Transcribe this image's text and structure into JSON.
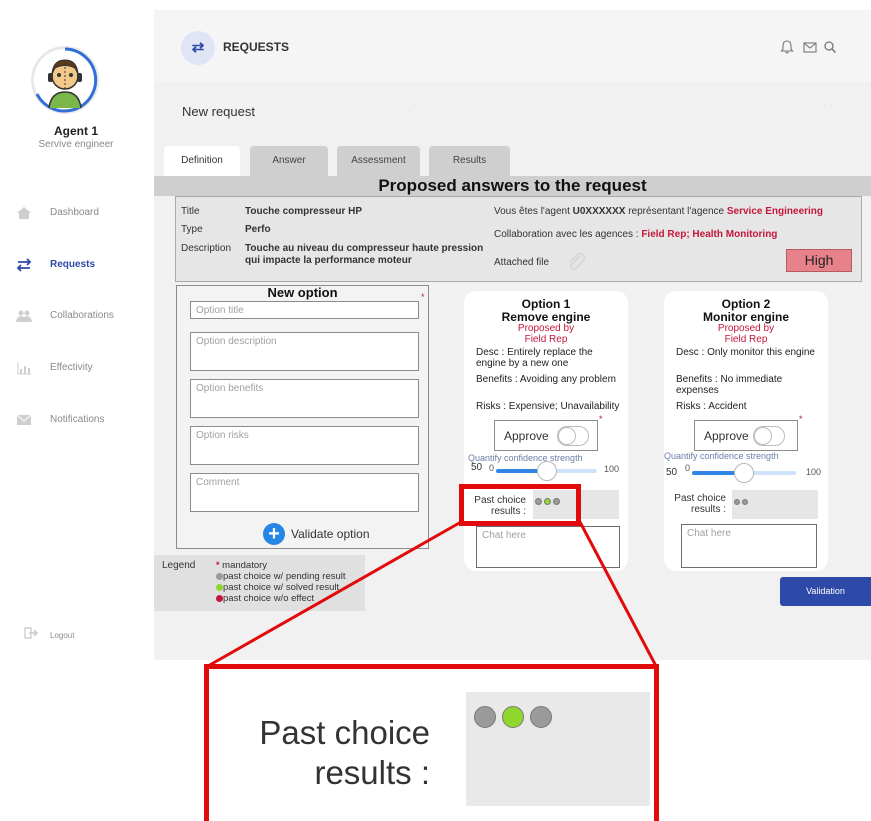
{
  "sidebar": {
    "agent_name": "Agent 1",
    "agent_role": "Servive engineer",
    "items": [
      {
        "label": "Dashboard",
        "icon": "home-icon",
        "active": false
      },
      {
        "label": "Requests",
        "icon": "swap-arrows-icon",
        "active": true
      },
      {
        "label": "Collaborations",
        "icon": "users-icon",
        "active": false
      },
      {
        "label": "Effectivity",
        "icon": "bar-chart-icon",
        "active": false
      },
      {
        "label": "Notifications",
        "icon": "envelope-icon",
        "active": false
      }
    ],
    "logout_label": "Logout"
  },
  "header": {
    "title": "REQUESTS",
    "icons": [
      "bell-icon",
      "mail-icon",
      "search-icon"
    ],
    "subtitle": "New request"
  },
  "tabs": [
    {
      "label": "Definition",
      "active": true
    },
    {
      "label": "Answer",
      "active": false
    },
    {
      "label": "Assessment",
      "active": false
    },
    {
      "label": "Results",
      "active": false
    }
  ],
  "page_title": "Proposed answers to the request",
  "request_info": {
    "title_label": "Title",
    "title_value": "Touche compresseur HP",
    "type_label": "Type",
    "type_value": "Perfo",
    "description_label": "Description",
    "description_line1": "Touche au niveau du compresseur haute pression",
    "description_line2": "qui impacte la performance moteur",
    "agent_text_prefix": "Vous êtes l'agent ",
    "agent_id": "U0XXXXXX",
    "agent_text_mid": " représentant l'agence ",
    "agency": "Service Engineering",
    "collab_prefix": "Collaboration avec les agences : ",
    "collab_agencies": "Field Rep; Health Monitoring",
    "attached_label": "Attached file",
    "priority": "High",
    "priority_color": "#e7828a"
  },
  "new_option": {
    "title": "New option",
    "title_placeholder": "Option title",
    "description_placeholder": "Option description",
    "benefits_placeholder": "Option benefits",
    "risks_placeholder": "Option risks",
    "comment_placeholder": "Comment",
    "validate_label": "Validate option"
  },
  "legend": {
    "title": "Legend",
    "mandatory": "mandatory",
    "pending": "past choice w/ pending result",
    "solved": "past choice w/ solved result",
    "no_effect": "past choice w/o effect",
    "colors": {
      "mandatory": "#c4173a",
      "pending": "#9a9a9a",
      "solved": "#8fd62f",
      "no_effect": "#c4173a"
    }
  },
  "options": [
    {
      "heading": "Option 1",
      "name": "Remove engine",
      "proposed_by_label": "Proposed by",
      "proposed_by": "Field Rep",
      "desc_line1": "Desc : Entirely replace the",
      "desc_line2": "engine by a new one",
      "benefits_line1": "Benefits : Avoiding any problem",
      "benefits_line2": "",
      "risks": "Risks : Expensive; Unavailability",
      "approve_label": "Approve",
      "confidence_label": "Quantify confidence strength",
      "slider_min": "0",
      "slider_max": "100",
      "slider_value_label": "50",
      "slider_fraction": 0.5,
      "past_choice_label1": "Past choice",
      "past_choice_label2": "results :",
      "past_dots": [
        "#9a9a9a",
        "#8fd62f",
        "#9a9a9a"
      ],
      "chat_placeholder": "Chat here"
    },
    {
      "heading": "Option 2",
      "name": "Monitor engine",
      "proposed_by_label": "Proposed by",
      "proposed_by": "Field Rep",
      "desc_line1": "Desc : Only monitor this engine",
      "desc_line2": "",
      "benefits_line1": "Benefits : No immediate",
      "benefits_line2": "expenses",
      "risks": "Risks : Accident",
      "approve_label": "Approve",
      "confidence_label": "Quantify confidence strength",
      "slider_min": "0",
      "slider_max": "100",
      "slider_value_label": "50",
      "slider_fraction": 0.5,
      "past_choice_label1": "Past choice",
      "past_choice_label2": "results :",
      "past_dots": [
        "#9a9a9a",
        "#9a9a9a"
      ],
      "chat_placeholder": "Chat here"
    }
  ],
  "validation_label": "Validation",
  "zoom": {
    "label_line1": "Past choice",
    "label_line2": "results :",
    "dots": [
      "#9a9a9a",
      "#8fd62f",
      "#9a9a9a"
    ]
  },
  "colors": {
    "accent": "#2f4aa8",
    "highlight": "#e10b0b",
    "danger": "#c4173a"
  }
}
